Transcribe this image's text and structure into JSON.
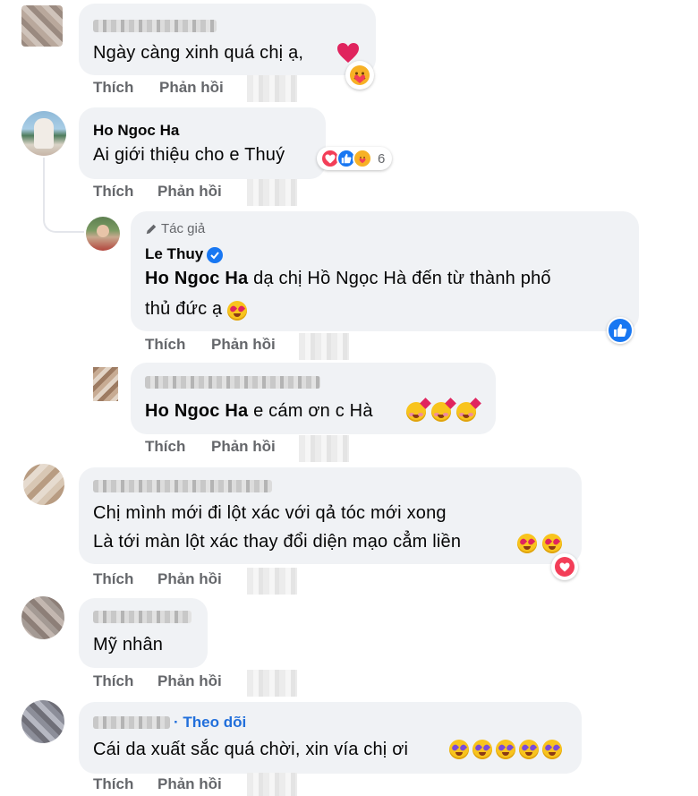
{
  "actions": {
    "like": "Thích",
    "reply": "Phản hồi"
  },
  "comments": [
    {
      "name": "",
      "text": "Ngày càng xinh quá chị ạ,",
      "reaction_icon": "care-icon"
    },
    {
      "name": "Ho Ngoc Ha",
      "text": "Ai giới thiệu cho e Thuý",
      "reaction_count": "6",
      "reaction_icons": [
        "heart-icon",
        "like-icon",
        "care-icon"
      ]
    },
    {
      "author_label": "Tác giả",
      "name": "Le Thuy",
      "verified": true,
      "mention": "Ho Ngoc Ha",
      "text_line1": " dạ chị Hồ Ngọc Hà đến từ thành phố",
      "text_line2": "thủ đức ạ",
      "reaction_icon": "like-icon"
    },
    {
      "name": "",
      "mention": "Ho Ngoc Ha",
      "text": " e cám ơn c Hà"
    },
    {
      "name": "",
      "text_line1": "Chị mình mới đi lột xác với qả tóc mới xong",
      "text_line2": "Là tới màn lột xác thay đổi diện mạo cẳm liền",
      "reaction_icon": "heart-icon"
    },
    {
      "name": "",
      "text": "Mỹ nhân"
    },
    {
      "name": "",
      "follow": "· Theo dõi",
      "text": "Cái da xuất sắc quá chời, xin vía chị ơi"
    }
  ]
}
